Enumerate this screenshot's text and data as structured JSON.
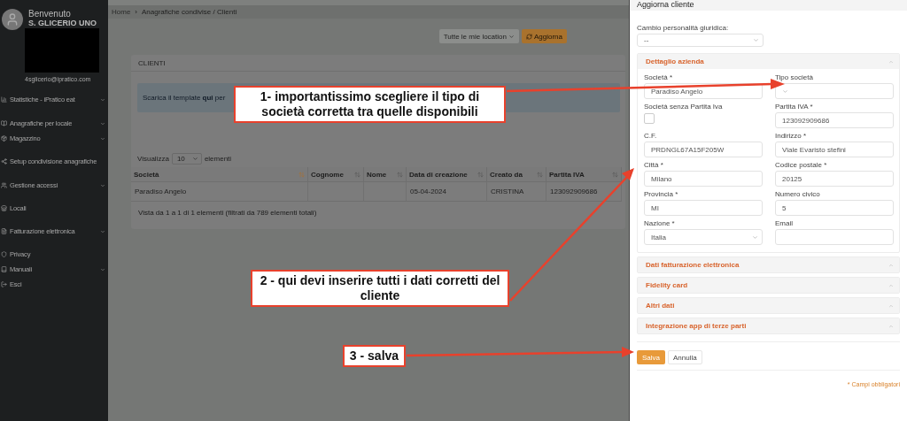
{
  "sidebar": {
    "welcome": "Benvenuto",
    "user": "S. GLICERIO UNO",
    "email": "4sglicerio@ipratico.com",
    "items": [
      {
        "label": "Statistiche - iPratico eat",
        "has_submenu": true
      },
      {
        "label": "Anagrafiche per locale",
        "has_submenu": true
      },
      {
        "label": "Magazzino",
        "has_submenu": true
      },
      {
        "label": "Setup condivisione anagrafiche",
        "has_submenu": false
      },
      {
        "label": "Gestione accessi",
        "has_submenu": true
      },
      {
        "label": "Locali",
        "has_submenu": false
      },
      {
        "label": "Fatturazione elettronica",
        "has_submenu": true
      },
      {
        "label": "Privacy",
        "has_submenu": false
      },
      {
        "label": "Manuali",
        "has_submenu": true
      },
      {
        "label": "Esci",
        "has_submenu": false
      }
    ]
  },
  "breadcrumb": {
    "home": "Home",
    "separator": "›",
    "current": "Anagrafiche condivise / Clienti"
  },
  "toolbar": {
    "location_button": "Tutte le mie location",
    "refresh_button": "Aggiorna"
  },
  "card": {
    "title": "CLIENTI",
    "alert": "Scarica il template **qui** per",
    "page_size_label": "Visualizza",
    "page_size": "10",
    "page_size_suffix": "elementi",
    "table": {
      "columns": [
        {
          "label": "Società",
          "sorted": true
        },
        {
          "label": "Cognome",
          "sorted": false
        },
        {
          "label": "Nome",
          "sorted": false
        },
        {
          "label": "Data di creazione",
          "sorted": false
        },
        {
          "label": "Creato da",
          "sorted": false
        },
        {
          "label": "Partita IVA",
          "sorted": false
        }
      ],
      "rows": [
        [
          "Paradiso Angelo",
          null,
          null,
          "05-04-2024",
          "CRISTINA",
          "123092909686"
        ]
      ]
    },
    "footer": "Vista da 1 a 1 di 1 elementi (filtrati da 789 elementi totali)"
  },
  "drawer": {
    "title": "Aggiorna cliente",
    "legal_label": "Cambio personalità giuridica:",
    "legal_value": "--",
    "sections": [
      {
        "title": "Dettaglio azienda",
        "fields": [
          {
            "kind": "text",
            "label": "Società *",
            "value": "Paradiso Angelo"
          },
          {
            "kind": "select",
            "label": "Tipo società"
          },
          {
            "kind": "checkbox",
            "label": "Società senza Partita Iva",
            "checked": false
          },
          {
            "kind": "text",
            "label": "Partita IVA *",
            "value": "123092909686"
          },
          {
            "kind": "text",
            "label": "C.F.",
            "value": "PRDNGL67A15F205W"
          },
          {
            "kind": "text",
            "label": "Indirizzo *",
            "value": "Viale Evaristo stefini"
          },
          {
            "kind": "text",
            "label": "Città *",
            "value": "Milano"
          },
          {
            "kind": "text",
            "label": "Codice postale *",
            "value": "20125"
          },
          {
            "kind": "text",
            "label": "Provincia *",
            "value": "MI"
          },
          {
            "kind": "text",
            "label": "Numero civico",
            "value": "5"
          },
          {
            "kind": "select",
            "label": "Nazione *",
            "value": "Italia"
          },
          {
            "kind": "text",
            "label": "Email"
          }
        ]
      },
      {
        "title": "Dati fatturazione elettronica"
      },
      {
        "title": "Fidelity card"
      },
      {
        "title": "Altri dati"
      },
      {
        "title": "Integrazione app di terze parti"
      }
    ],
    "save_button": "Salva",
    "cancel_button": "Annulla",
    "required_note": "* Campi obbligatori"
  },
  "annotations": [
    {
      "text": "1- importantissimo scegliere il tipo di società corretta tra quelle disponibili"
    },
    {
      "text": "2 - qui devi inserire tutti i dati corretti del cliente"
    },
    {
      "text": "3 - salva"
    }
  ]
}
